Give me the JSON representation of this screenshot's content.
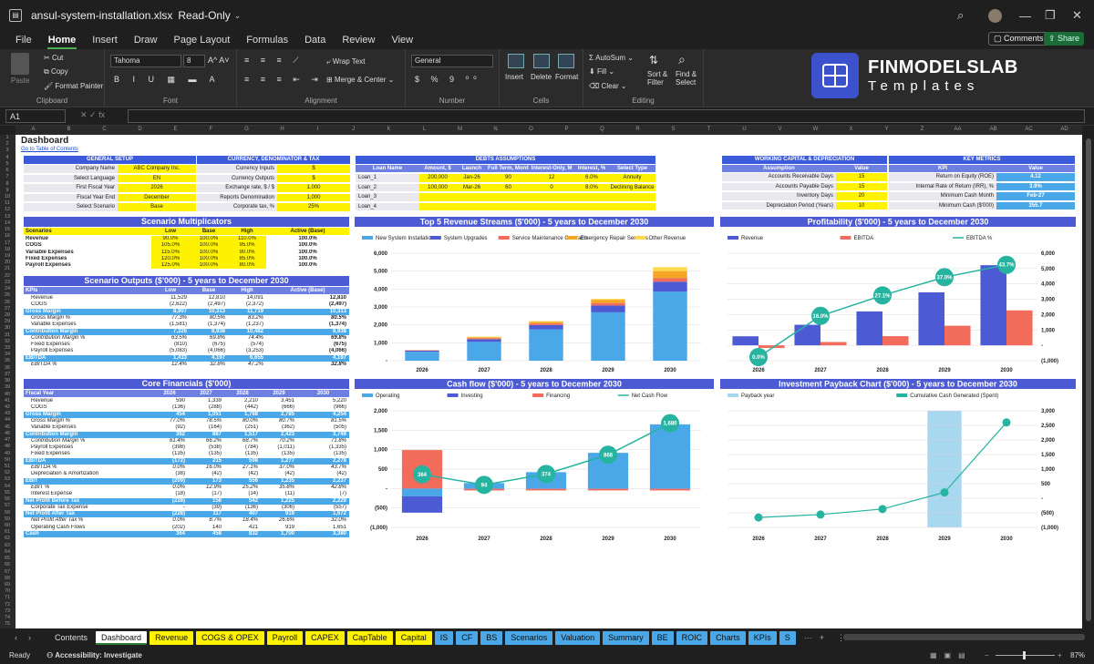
{
  "window": {
    "filename": "ansul-system-installation.xlsx",
    "mode": "Read-Only"
  },
  "menu": [
    "File",
    "Home",
    "Insert",
    "Draw",
    "Page Layout",
    "Formulas",
    "Data",
    "Review",
    "View"
  ],
  "menu_active": "Home",
  "topright": {
    "comments": "Comments",
    "share": "Share"
  },
  "ribbon": {
    "clipboard": {
      "paste": "Paste",
      "cut": "Cut",
      "copy": "Copy",
      "format_painter": "Format Painter",
      "label": "Clipboard"
    },
    "font": {
      "family": "Tahoma",
      "size": "8",
      "label": "Font"
    },
    "alignment": {
      "wrap": "Wrap Text",
      "merge": "Merge & Center",
      "label": "Alignment"
    },
    "number": {
      "format": "General",
      "label": "Number"
    },
    "cells": {
      "insert": "Insert",
      "delete": "Delete",
      "format": "Format",
      "label": "Cells"
    },
    "editing": {
      "autosum": "AutoSum",
      "fill": "Fill",
      "clear": "Clear",
      "sort": "Sort & Filter",
      "find": "Find & Select",
      "label": "Editing"
    }
  },
  "brand": {
    "name": "FINMODELSLAB",
    "sub": "Templates"
  },
  "namebox": "A1",
  "columns": [
    "A",
    "B",
    "C",
    "D",
    "E",
    "F",
    "G",
    "H",
    "I",
    "J",
    "K",
    "L",
    "M",
    "N",
    "O",
    "P",
    "Q",
    "R",
    "S",
    "T",
    "U",
    "V",
    "W",
    "X",
    "Y",
    "Z",
    "AA",
    "AB",
    "AC",
    "AD"
  ],
  "sheet": {
    "title": "Dashboard",
    "link": "Go to Table of Contents",
    "general": {
      "header": "GENERAL SETUP",
      "rows": [
        [
          "Company Name",
          "ABC Company Inc."
        ],
        [
          "Select Language",
          "EN"
        ],
        [
          "First Fiscal Year",
          "2026"
        ],
        [
          "Fiscal Year End",
          "December"
        ],
        [
          "Select Scenario",
          "Base"
        ]
      ]
    },
    "currency": {
      "header": "CURRENCY, DENOMINATOR & TAX",
      "rows": [
        [
          "Currency Inputs",
          "$"
        ],
        [
          "Currency Outputs",
          "$"
        ],
        [
          "Exchange rate, $ / $",
          "1.000"
        ],
        [
          "Reports Denomination",
          "1,000"
        ],
        [
          "Corporate tax, %",
          "25%"
        ]
      ]
    },
    "debts": {
      "header": "DEBTS ASSUMPTIONS",
      "cols": [
        "Loan Name",
        "Amount, $",
        "Launch",
        "Full Term, Months",
        "Interest-Only, M",
        "Interest, %",
        "Select Type"
      ],
      "rows": [
        [
          "Loan_1",
          "200,000",
          "Jan-26",
          "90",
          "12",
          "6.0%",
          "Annuity"
        ],
        [
          "Loan_2",
          "100,000",
          "Mar-26",
          "60",
          "0",
          "8.0%",
          "Declining Balance"
        ],
        [
          "Loan_3",
          "",
          "",
          "",
          "",
          "",
          ""
        ],
        [
          "Loan_4",
          "",
          "",
          "",
          "",
          "",
          ""
        ]
      ]
    },
    "wc": {
      "header": "WORKING CAPITAL & DEPRECIATION",
      "cols": [
        "Assumption",
        "Value"
      ],
      "rows": [
        [
          "Accounts Receivable Days",
          "15"
        ],
        [
          "Accounts Payable Days",
          "15"
        ],
        [
          "Inventory Days",
          "20"
        ],
        [
          "Depreciation Period (Years)",
          "10"
        ]
      ]
    },
    "kpi": {
      "header": "KEY METRICS",
      "cols": [
        "KPI",
        "Value"
      ],
      "rows": [
        [
          "Return on Equity (ROE)",
          "4.12"
        ],
        [
          "Internal Rate of Return (IRR), %",
          "3.9%"
        ],
        [
          "Minimum Cash Month",
          "Feb-27"
        ],
        [
          "Minimum Cash ($'000)",
          "355.7"
        ]
      ]
    },
    "mult": {
      "header": "Scenario Multiplicators",
      "cols": [
        "Scenarios",
        "Low",
        "Base",
        "High",
        "Active (Base)"
      ],
      "rows": [
        [
          "Revenue",
          "90.0%",
          "100.0%",
          "110.0%",
          "100.0%"
        ],
        [
          "COGS",
          "105.0%",
          "100.0%",
          "95.0%",
          "100.0%"
        ],
        [
          "Variable Expenses",
          "115.0%",
          "100.0%",
          "90.0%",
          "100.0%"
        ],
        [
          "Fixed Expenses",
          "120.0%",
          "100.0%",
          "85.0%",
          "100.0%"
        ],
        [
          "Payroll Expenses",
          "125.0%",
          "100.0%",
          "80.0%",
          "100.0%"
        ]
      ]
    },
    "outputs": {
      "header": "Scenario Outputs ($'000) - 5 years to December 2030",
      "cols": [
        "KPIs",
        "Low",
        "Base",
        "High",
        "Active (Base)"
      ],
      "rows": [
        [
          "Revenue",
          "11,529",
          "12,810",
          "14,091",
          "12,810",
          ""
        ],
        [
          "COGS",
          "(2,622)",
          "(2,497)",
          "(2,372)",
          "(2,497)",
          ""
        ],
        [
          "Gross Margin",
          "8,907",
          "10,313",
          "11,719",
          "10,313",
          "hl"
        ],
        [
          "Gross Margin %",
          "77.3%",
          "80.5%",
          "83.2%",
          "80.5%",
          "sub"
        ],
        [
          "Variable Expenses",
          "(1,581)",
          "(1,374)",
          "(1,237)",
          "(1,374)",
          ""
        ],
        [
          "Contribution Margin",
          "7,326",
          "8,938",
          "10,482",
          "8,938",
          "hl"
        ],
        [
          "Contribution Margin %",
          "63.5%",
          "69.8%",
          "74.4%",
          "69.8%",
          "sub"
        ],
        [
          "Fixed Expenses",
          "(810)",
          "(675)",
          "(574)",
          "(675)",
          ""
        ],
        [
          "Payroll Expenses",
          "(5,083)",
          "(4,066)",
          "(3,253)",
          "(4,066)",
          ""
        ],
        [
          "EBITDA",
          "1,433",
          "4,197",
          "6,655",
          "4,197",
          "hl"
        ],
        [
          "EBITDA %",
          "12.4%",
          "32.8%",
          "47.2%",
          "32.8%",
          "sub"
        ]
      ]
    },
    "core": {
      "header": "Core Financials ($'000)",
      "cols": [
        "Fiscal Year",
        "2026",
        "2027",
        "2028",
        "2029",
        "2030"
      ],
      "rows": [
        [
          "Revenue",
          "590",
          "1,339",
          "2,210",
          "3,451",
          "5,220",
          ""
        ],
        [
          "COGS",
          "(136)",
          "(288)",
          "(442)",
          "(666)",
          "(966)",
          ""
        ],
        [
          "Gross Margin",
          "454",
          "1,051",
          "1,768",
          "2,785",
          "4,254",
          "hl"
        ],
        [
          "Gross Margin %",
          "77.0%",
          "78.5%",
          "80.0%",
          "80.7%",
          "81.5%",
          "sub"
        ],
        [
          "Variable Expenses",
          "(92)",
          "(164)",
          "(251)",
          "(362)",
          "(505)",
          ""
        ],
        [
          "Contribution Margin",
          "362",
          "887",
          "1,517",
          "2,423",
          "3,749",
          "hl"
        ],
        [
          "Contribution Margin %",
          "61.4%",
          "66.2%",
          "68.7%",
          "70.2%",
          "71.8%",
          "sub"
        ],
        [
          "Payroll Expenses",
          "(398)",
          "(538)",
          "(784)",
          "(1,011)",
          "(1,335)",
          ""
        ],
        [
          "Fixed Expenses",
          "(135)",
          "(135)",
          "(135)",
          "(135)",
          "(135)",
          ""
        ],
        [
          "EBITDA",
          "(172)",
          "215",
          "598",
          "1,277",
          "2,278",
          "hl"
        ],
        [
          "EBITDA %",
          "0.0%",
          "16.0%",
          "27.1%",
          "37.0%",
          "43.7%",
          "sub"
        ],
        [
          "Depreciation & Amortization",
          "(38)",
          "(42)",
          "(42)",
          "(42)",
          "(42)",
          ""
        ],
        [
          "EBIT",
          "(209)",
          "173",
          "556",
          "1,235",
          "2,237",
          "hl"
        ],
        [
          "EBIT %",
          "0.0%",
          "12.9%",
          "25.2%",
          "35.8%",
          "42.8%",
          "sub"
        ],
        [
          "Interest Expense",
          "(18)",
          "(17)",
          "(14)",
          "(11)",
          "(7)",
          ""
        ],
        [
          "Net Profit Before Tax",
          "(228)",
          "156",
          "542",
          "1,225",
          "2,229",
          "hl"
        ],
        [
          "Corporate Tax Expense",
          "-",
          "(39)",
          "(136)",
          "(306)",
          "(557)",
          ""
        ],
        [
          "Net Profit After Tax",
          "(228)",
          "117",
          "407",
          "919",
          "1,672",
          "hl"
        ],
        [
          "Net Profit After Tax %",
          "0.0%",
          "8.7%",
          "18.4%",
          "26.6%",
          "32.0%",
          "sub"
        ],
        [
          "Operating Cash Flows",
          "(202)",
          "140",
          "421",
          "919",
          "1,651",
          ""
        ],
        [
          "Cash",
          "364",
          "458",
          "832",
          "1,700",
          "3,380",
          "hl"
        ]
      ]
    }
  },
  "charts": {
    "revenue": {
      "title": "Top 5 Revenue Streams ($'000) - 5 years to December 2030"
    },
    "profit": {
      "title": "Profitability ($'000) - 5 years to December 2030"
    },
    "cash": {
      "title": "Cash flow ($'000) - 5 years to December 2030"
    },
    "payback": {
      "title": "Investment Payback Chart ($'000) - 5 years to December 2030"
    }
  },
  "chart_data": [
    {
      "type": "bar",
      "stacked": true,
      "title": "Top 5 Revenue Streams ($'000) - 5 years to December 2030",
      "categories": [
        "2026",
        "2027",
        "2028",
        "2029",
        "2030"
      ],
      "ylim": [
        0,
        6000
      ],
      "yticks": [
        "-",
        "1,000",
        "2,000",
        "3,000",
        "4,000",
        "5,000",
        "6,000"
      ],
      "legend": "top",
      "series": [
        {
          "name": "New System Installation",
          "color": "#4aa8e8",
          "values": [
            500,
            1050,
            1750,
            2700,
            3850
          ]
        },
        {
          "name": "System Upgrades",
          "color": "#4c5bd4",
          "values": [
            60,
            150,
            240,
            380,
            560
          ]
        },
        {
          "name": "Service Maintenance Contracts",
          "color": "#f26b5b",
          "values": [
            20,
            50,
            90,
            140,
            210
          ]
        },
        {
          "name": "Emergency Repair Services",
          "color": "#f5a623",
          "values": [
            10,
            60,
            90,
            180,
            380
          ]
        },
        {
          "name": "Other Revenue",
          "color": "#ffd84d",
          "values": [
            0,
            29,
            40,
            51,
            220
          ]
        }
      ]
    },
    {
      "type": "bar",
      "title": "Profitability ($'000) - 5 years to December 2030",
      "categories": [
        "2026",
        "2027",
        "2028",
        "2029",
        "2030"
      ],
      "ylim": [
        -1000,
        6000
      ],
      "yticks": [
        "(1,000)",
        "-",
        "1,000",
        "2,000",
        "3,000",
        "4,000",
        "5,000",
        "6,000"
      ],
      "legend": "top",
      "series": [
        {
          "name": "Revenue",
          "color": "#4c5bd4",
          "values": [
            590,
            1339,
            2210,
            3451,
            5220
          ]
        },
        {
          "name": "EBITDA",
          "color": "#f26b5b",
          "values": [
            -172,
            215,
            598,
            1277,
            2278
          ]
        },
        {
          "name": "EBITDA %",
          "color": "#26b3a0",
          "values": [
            0.0,
            16.0,
            27.1,
            37.0,
            43.7
          ],
          "labels": [
            "0.0%",
            "16.0%",
            "27.1%",
            "37.0%",
            "43.7%"
          ],
          "type": "line"
        }
      ]
    },
    {
      "type": "bar",
      "title": "Cash flow ($'000) - 5 years to December 2030",
      "categories": [
        "2026",
        "2027",
        "2028",
        "2029",
        "2030"
      ],
      "ylim": [
        -1000,
        2000
      ],
      "yticks": [
        "(1,000)",
        "(500)",
        "-",
        "500",
        "1,000",
        "1,500",
        "2,000"
      ],
      "legend": "top",
      "series": [
        {
          "name": "Operating",
          "color": "#4aa8e8",
          "values": [
            -202,
            140,
            421,
            919,
            1651
          ]
        },
        {
          "name": "Investing",
          "color": "#4c5bd4",
          "values": [
            -420,
            -10,
            -10,
            -10,
            -10
          ]
        },
        {
          "name": "Financing",
          "color": "#f26b5b",
          "values": [
            990,
            -40,
            -40,
            -40,
            -40
          ]
        },
        {
          "name": "Net Cash Flow",
          "color": "#26b3a0",
          "values": [
            364,
            94,
            374,
            868,
            1680
          ],
          "labels": [
            "364",
            "94",
            "374",
            "868",
            "1,680"
          ],
          "type": "line"
        }
      ]
    },
    {
      "type": "line",
      "title": "Investment Payback Chart ($'000) - 5 years to December 2030",
      "categories": [
        "2026",
        "2027",
        "2028",
        "2029",
        "2030"
      ],
      "ylim": [
        -1000,
        3000
      ],
      "yticks": [
        "(1,000)",
        "(500)",
        "-",
        "500",
        "1,000",
        "1,500",
        "2,000",
        "2,500",
        "3,000"
      ],
      "legend": "top",
      "series": [
        {
          "name": "Payback year",
          "color": "#a8d8f0",
          "values": [
            0,
            0,
            0,
            1,
            0
          ],
          "type": "bar"
        },
        {
          "name": "Cumulative Cash Generated (Spent)",
          "color": "#26b3a0",
          "values": [
            -660,
            -560,
            -370,
            200,
            2600
          ]
        }
      ]
    }
  ],
  "sheet_tabs": [
    {
      "label": "Contents",
      "color": "#1f1f1f",
      "fg": "#ddd"
    },
    {
      "label": "Dashboard",
      "color": "#ffffff",
      "fg": "#111",
      "active": true
    },
    {
      "label": "Revenue",
      "color": "#fff200"
    },
    {
      "label": "COGS & OPEX",
      "color": "#fff200"
    },
    {
      "label": "Payroll",
      "color": "#fff200"
    },
    {
      "label": "CAPEX",
      "color": "#fff200"
    },
    {
      "label": "CapTable",
      "color": "#fff200"
    },
    {
      "label": "Capital",
      "color": "#fff200"
    },
    {
      "label": "IS",
      "color": "#4aa8e8"
    },
    {
      "label": "CF",
      "color": "#4aa8e8"
    },
    {
      "label": "BS",
      "color": "#4aa8e8"
    },
    {
      "label": "Scenarios",
      "color": "#4aa8e8"
    },
    {
      "label": "Valuation",
      "color": "#4aa8e8"
    },
    {
      "label": "Summary",
      "color": "#4aa8e8"
    },
    {
      "label": "BE",
      "color": "#4aa8e8"
    },
    {
      "label": "ROIC",
      "color": "#4aa8e8"
    },
    {
      "label": "Charts",
      "color": "#4aa8e8"
    },
    {
      "label": "KPIs",
      "color": "#4aa8e8"
    },
    {
      "label": "S",
      "color": "#4aa8e8"
    }
  ],
  "status": {
    "ready": "Ready",
    "accessibility": "Accessibility: Investigate",
    "zoom": "87%"
  }
}
